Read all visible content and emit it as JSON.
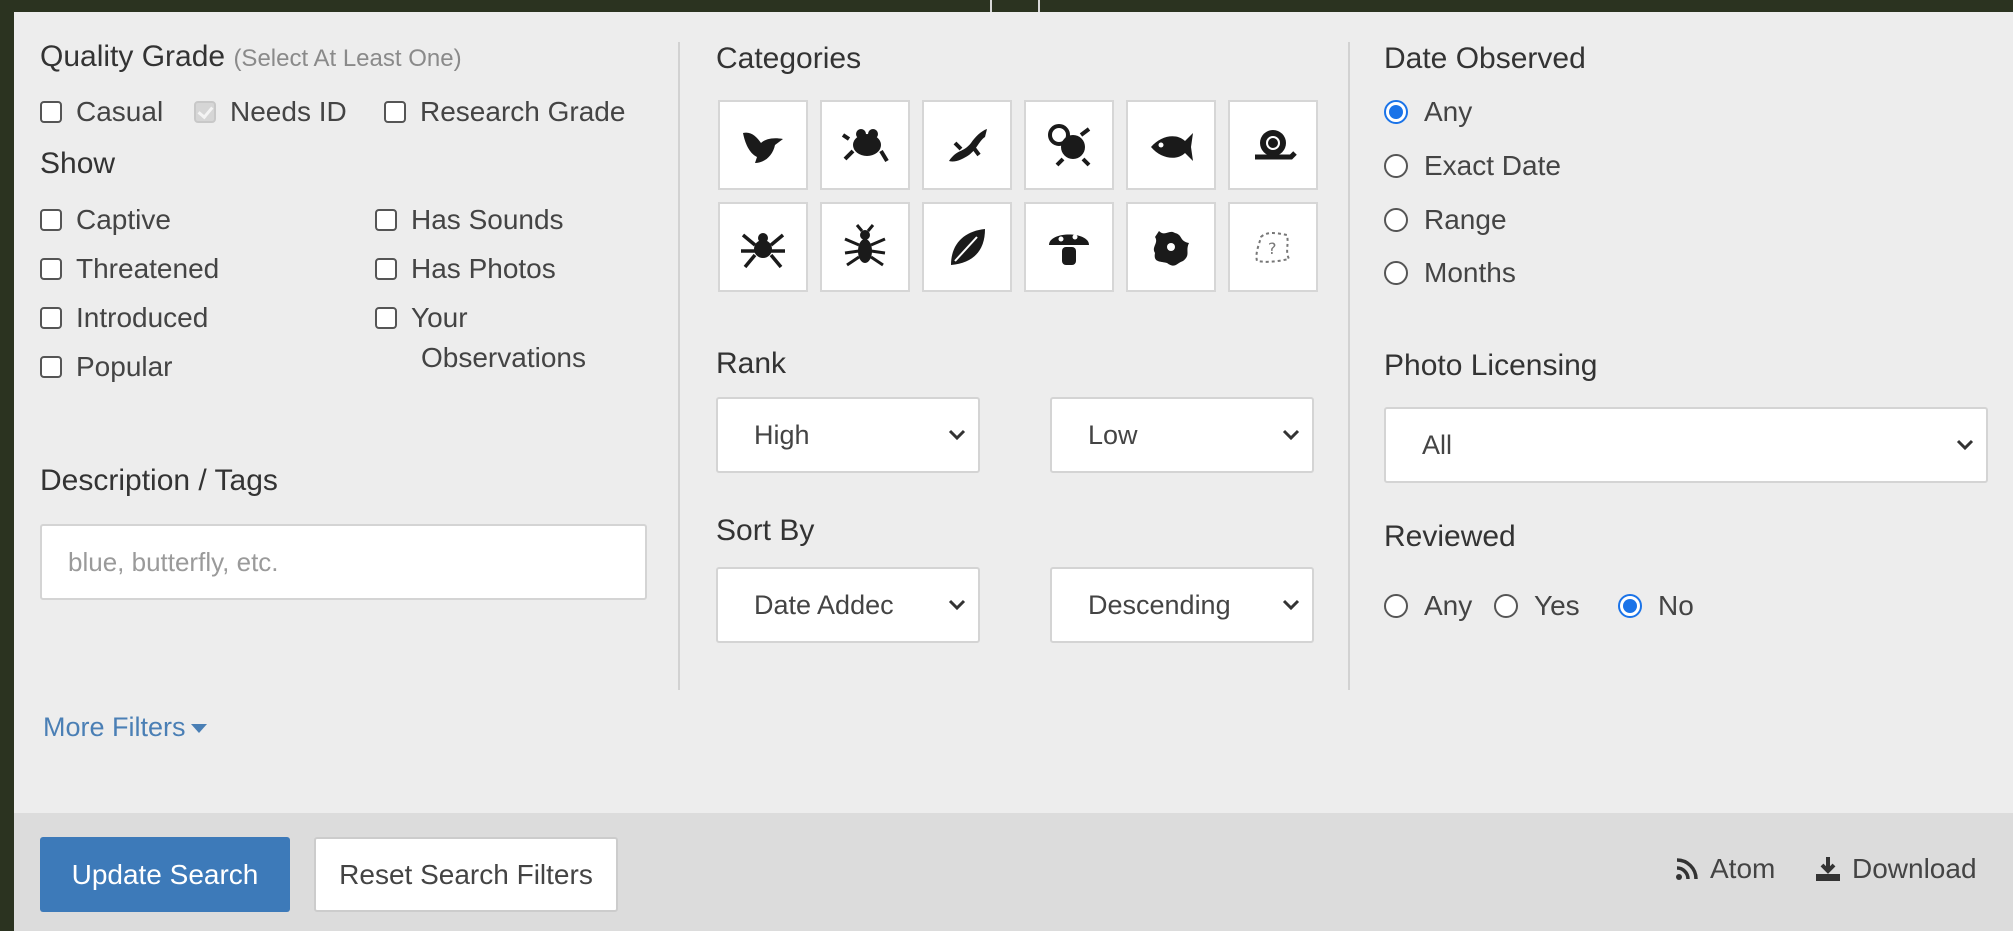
{
  "quality_grade": {
    "title": "Quality Grade",
    "hint": "(Select At Least One)",
    "options": [
      {
        "label": "Casual",
        "checked": false
      },
      {
        "label": "Needs ID",
        "checked": true,
        "disabled": true
      },
      {
        "label": "Research Grade",
        "checked": false
      }
    ]
  },
  "show": {
    "title": "Show",
    "left": [
      "Captive",
      "Threatened",
      "Introduced",
      "Popular"
    ],
    "right": [
      "Has Sounds",
      "Has Photos",
      "Your",
      "Observations"
    ]
  },
  "description": {
    "title": "Description / Tags",
    "placeholder": "blue, butterfly, etc."
  },
  "categories": {
    "title": "Categories",
    "icons": [
      "bird-icon",
      "amphibian-icon",
      "reptile-icon",
      "mammal-icon",
      "fish-icon",
      "mollusk-icon",
      "arachnid-icon",
      "insect-icon",
      "plant-icon",
      "fungi-icon",
      "protozoa-icon",
      "unknown-icon"
    ]
  },
  "rank": {
    "title": "Rank",
    "high": "High",
    "low": "Low"
  },
  "sort_by": {
    "title": "Sort By",
    "field": "Date Addec",
    "order": "Descending"
  },
  "date_observed": {
    "title": "Date Observed",
    "options": [
      "Any",
      "Exact Date",
      "Range",
      "Months"
    ],
    "selected": "Any"
  },
  "photo_licensing": {
    "title": "Photo Licensing",
    "value": "All"
  },
  "reviewed": {
    "title": "Reviewed",
    "options": [
      "Any",
      "Yes",
      "No"
    ],
    "selected": "No"
  },
  "more_filters": "More Filters",
  "footer": {
    "update": "Update Search",
    "reset": "Reset Search Filters",
    "atom": "Atom",
    "download": "Download"
  },
  "colors": {
    "primary_button": "#3d7ab9",
    "radio_selected": "#1a73e8",
    "link": "#4a7fb5"
  }
}
